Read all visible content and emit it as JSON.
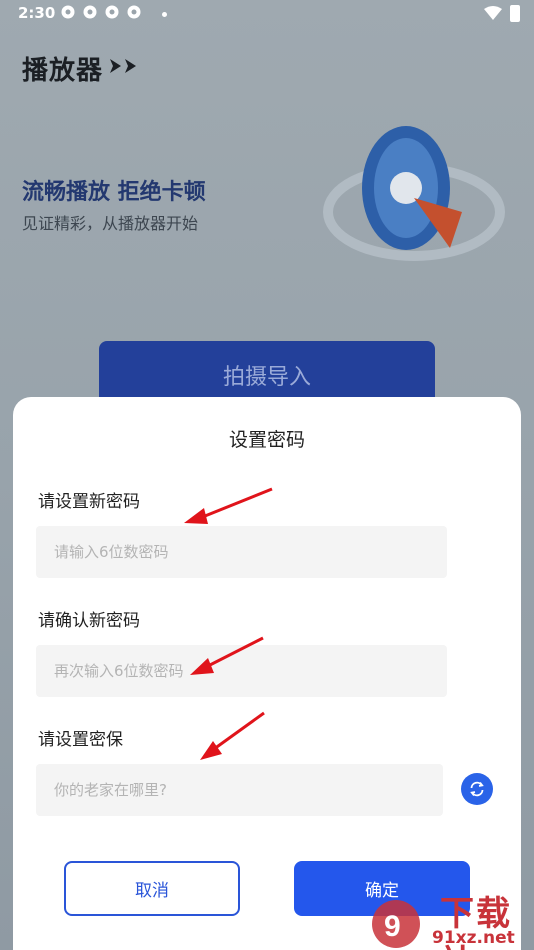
{
  "status_bar": {
    "time": "2:30"
  },
  "app": {
    "logo": "播放器",
    "slogan_title": "流畅播放 拒绝卡顿",
    "slogan_sub": "见证精彩，从播放器开始",
    "import_label": "拍摄导入"
  },
  "dialog": {
    "title": "设置密码",
    "new_pwd_label": "请设置新密码",
    "new_pwd_placeholder": "请输入6位数密码",
    "confirm_pwd_label": "请确认新密码",
    "confirm_pwd_placeholder": "再次输入6位数密码",
    "security_label": "请设置密保",
    "security_placeholder": "你的老家在哪里?",
    "cancel_label": "取消",
    "confirm_label": "确定"
  },
  "watermark": {
    "text": "下载站",
    "url": "91xz.net"
  },
  "colors": {
    "accent": "#2457ec",
    "annotation": "#e0141b"
  }
}
